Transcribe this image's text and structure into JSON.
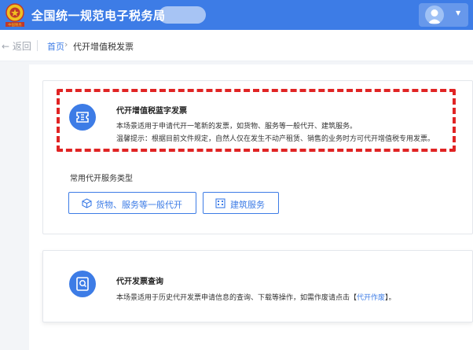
{
  "header": {
    "emblem_text": "中国税务",
    "app_title": "全国统一规范电子税务局",
    "colors": {
      "brand_blue": "#3d7ce6",
      "alert_red": "#e02424"
    },
    "user_icon": "user-avatar-icon",
    "dropdown_icon": "caret-down-icon"
  },
  "breadcrumb": {
    "back_label": "返回",
    "home_label": "首页",
    "separator": "›",
    "current_label": "代开增值税发票"
  },
  "cards": {
    "blue_invoice": {
      "icon": "invoice-ticket-icon",
      "title": "代开增值税蓝字发票",
      "description": "本场景适用于申请代开一笔新的发票，如货物、服务等一般代开、建筑服务。",
      "tip": "温馨提示：根据目前文件规定，自然人仅在发生不动产租赁、销售的业务时方可代开增值税专用发票。"
    },
    "query": {
      "icon": "invoice-query-icon",
      "title": "代开发票查询",
      "description_prefix": "本场景适用于历史代开发票申请信息的查询、下载等操作，如需作废请点击【",
      "description_link": "代开作废",
      "description_suffix": "】。"
    }
  },
  "common_services": {
    "label": "常用代开服务类型",
    "buttons": [
      {
        "label": "货物、服务等一般代开",
        "icon": "goods-box-icon"
      },
      {
        "label": "建筑服务",
        "icon": "building-icon"
      }
    ]
  }
}
